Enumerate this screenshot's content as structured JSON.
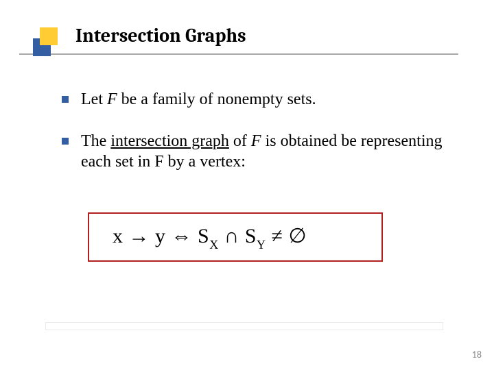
{
  "title": "Intersection Graphs",
  "bullets": [
    {
      "pre": "Let ",
      "it": "F",
      "post": " be a family of nonempty sets."
    },
    {
      "pre": "The ",
      "ul": "intersection graph",
      "mid": " of ",
      "it": "F",
      "post": " is obtained be representing each set in F by a vertex:"
    }
  ],
  "formula": {
    "xy": "x → y",
    "iff": "  ⇔  ",
    "sx": "S",
    "subx": "X",
    "cap": " ∩ ",
    "sy": "S",
    "suby": "Y",
    "ne": " ≠ ",
    "empty": "∅"
  },
  "page_number": "18",
  "icons": {
    "bullet_shape": "square-icon",
    "corner_shape": "double-square-icon"
  }
}
